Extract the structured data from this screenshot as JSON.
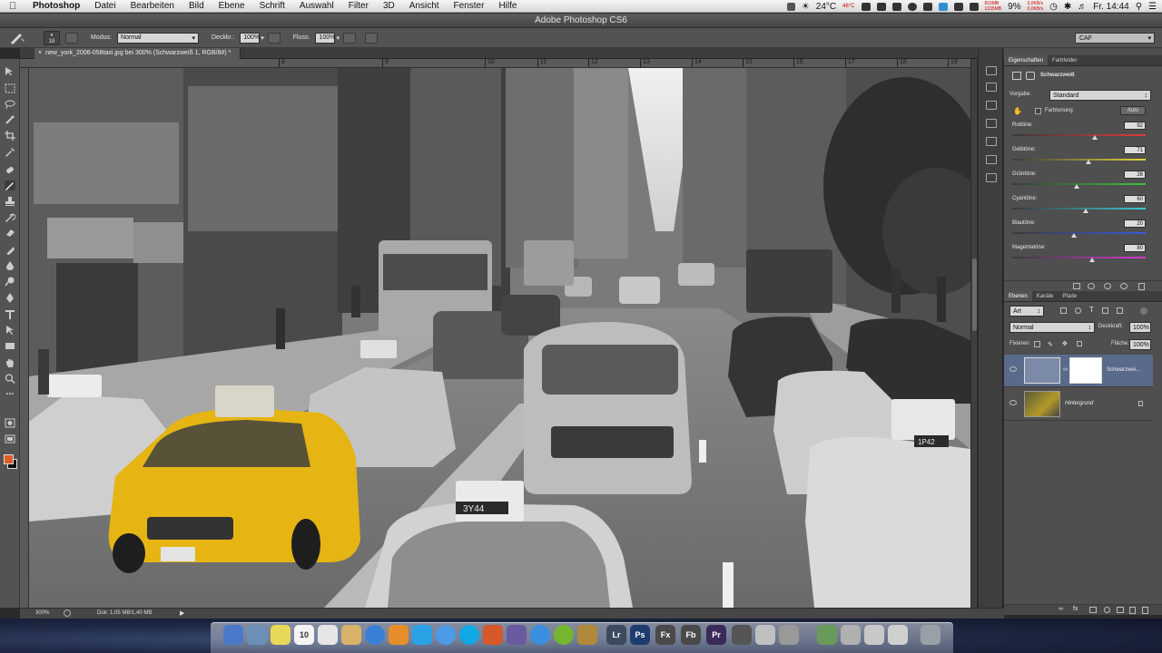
{
  "menubar": {
    "items": [
      "Photoshop",
      "Datei",
      "Bearbeiten",
      "Bild",
      "Ebene",
      "Schrift",
      "Auswahl",
      "Filter",
      "3D",
      "Ansicht",
      "Fenster",
      "Hilfe"
    ],
    "temperature": "24°C",
    "temp_mini": "46°C",
    "mem_line1": "815MB",
    "mem_line2": "1335MB",
    "battery": "9%",
    "net_line1": "0,0KB/s",
    "net_line2": "0,0KB/s",
    "clock": "Fr. 14:44"
  },
  "window": {
    "title": "Adobe Photoshop CS6"
  },
  "options": {
    "brush_size": "18",
    "mode_label": "Modus:",
    "mode_value": "Normal",
    "opacity_label": "Deckkr.:",
    "opacity_value": "100%",
    "flow_label": "Fluss:",
    "flow_value": "100%",
    "workspace": "CAF"
  },
  "document": {
    "tab_title": "new_york_2006-058taxi.jpg bei 300% (Schwarzweiß 1, RGB/8#) *",
    "zoom": "300%",
    "doc_size": "Dok: 1,05 MB/1,40 MB",
    "ruler_ticks": [
      "8",
      "9",
      "10",
      "11",
      "12",
      "13",
      "14",
      "15",
      "16",
      "17",
      "18",
      "19",
      "20",
      "21"
    ],
    "plate_left": "3Y44",
    "plate_right": "1P42"
  },
  "properties": {
    "tabs": [
      "Eigenschaften",
      "Farbfelder"
    ],
    "adjustment": "Schwarzweiß",
    "preset_label": "Vorgabe:",
    "preset_value": "Standard",
    "tint_label": "Farbtonung",
    "auto_label": "Auto",
    "sliders": [
      {
        "label": "Rottöne:",
        "value": "92",
        "pos": 0.62
      },
      {
        "label": "Gelbtöne:",
        "value": "71",
        "pos": 0.57
      },
      {
        "label": "Grüntöne:",
        "value": "26",
        "pos": 0.48
      },
      {
        "label": "Cyantöne:",
        "value": "60",
        "pos": 0.55
      },
      {
        "label": "Blautöne:",
        "value": "20",
        "pos": 0.46
      },
      {
        "label": "Magentatöne:",
        "value": "80",
        "pos": 0.6
      }
    ]
  },
  "layers": {
    "tabs": [
      "Ebenen",
      "Kanäle",
      "Pfade"
    ],
    "filter": "Art",
    "blend": "Normal",
    "opacity_label": "Deckkraft:",
    "opacity_value": "100%",
    "lock_label": "Fixieren:",
    "fill_label": "Fläche:",
    "fill_value": "100%",
    "items": [
      {
        "name": "Schwarzwei...",
        "selected": true
      },
      {
        "name": "Hintergrund",
        "selected": false
      }
    ]
  },
  "dock": {
    "labels": [
      "Lr",
      "Ps",
      "Fx",
      "Fb",
      "Pr"
    ]
  },
  "colors": {
    "foreground": "#e15c27",
    "background": "#111111",
    "accent_selection": "#5a6a8a"
  },
  "icons": [
    "apple-icon",
    "brush-tool-icon",
    "move-tool-icon",
    "marquee-icon",
    "lasso-icon",
    "crop-icon",
    "eyedropper-icon",
    "healing-icon",
    "brush-icon",
    "stamp-icon",
    "history-brush-icon",
    "eraser-icon",
    "gradient-icon",
    "blur-icon",
    "dodge-icon",
    "pen-icon",
    "type-icon",
    "path-select-icon",
    "shape-icon",
    "hand-icon",
    "zoom-icon",
    "eye-icon",
    "lock-icon",
    "trash-icon"
  ]
}
